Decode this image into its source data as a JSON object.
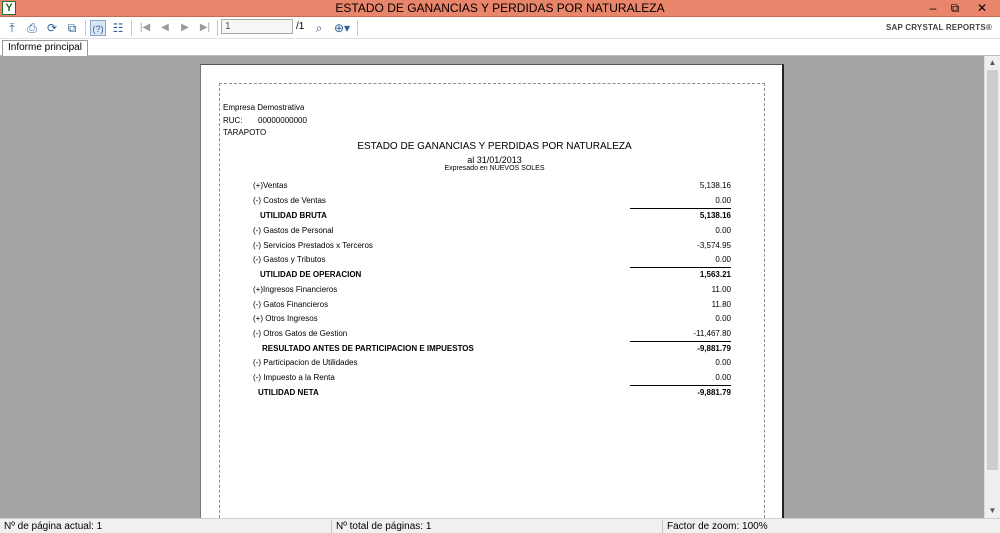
{
  "window": {
    "title": "ESTADO DE GANANCIAS Y PERDIDAS POR NATURALEZA",
    "app_icon": "crystal-reports-icon",
    "minimize": "–",
    "restore": "⧉",
    "close": "✕"
  },
  "toolbar": {
    "page_input": "1",
    "page_total": "/1",
    "brand": "SAP CRYSTAL REPORTS®"
  },
  "tabs": [
    {
      "label": "Informe principal"
    }
  ],
  "report": {
    "company": "Empresa Demostrativa",
    "ruc_label": "RUC:",
    "ruc_value": "00000000000",
    "city": "TARAPOTO",
    "title": "ESTADO DE GANANCIAS Y PERDIDAS POR NATURALEZA",
    "date": "al 31/01/2013",
    "currency": "Expresado en NUEVOS SOLES",
    "rows": [
      {
        "label": "(+)Ventas",
        "value": "5,138.16"
      },
      {
        "label": "(-) Costos de Ventas",
        "value": "0.00"
      },
      {
        "label": "UTILIDAD BRUTA",
        "value": "5,138.16"
      },
      {
        "label": "(-) Gastos de Personal",
        "value": "0.00"
      },
      {
        "label": "(-) Servicios Prestados x Terceros",
        "value": "-3,574.95"
      },
      {
        "label": "(-) Gastos y Tributos",
        "value": "0.00"
      },
      {
        "label": "UTILIDAD DE OPERACION",
        "value": "1,563.21"
      },
      {
        "label": "(+)Ingresos Financieros",
        "value": "11.00"
      },
      {
        "label": "(-) Gatos Financieros",
        "value": "11.80"
      },
      {
        "label": "(+) Otros Ingresos",
        "value": "0.00"
      },
      {
        "label": "(-) Otros Gatos de Gestion",
        "value": "-11,467.80"
      },
      {
        "label": "RESULTADO ANTES DE PARTICIPACION E IMPUESTOS",
        "value": "-9,881.79"
      },
      {
        "label": "(-) Participacion de Utilidades",
        "value": "0.00"
      },
      {
        "label": "(-) Impuesto a la Renta",
        "value": "0.00"
      },
      {
        "label": "UTILIDAD NETA",
        "value": "-9,881.79"
      }
    ]
  },
  "status": {
    "current_page": "Nº de página actual: 1",
    "total_pages": "Nº total de páginas: 1",
    "zoom": "Factor de zoom: 100%"
  }
}
